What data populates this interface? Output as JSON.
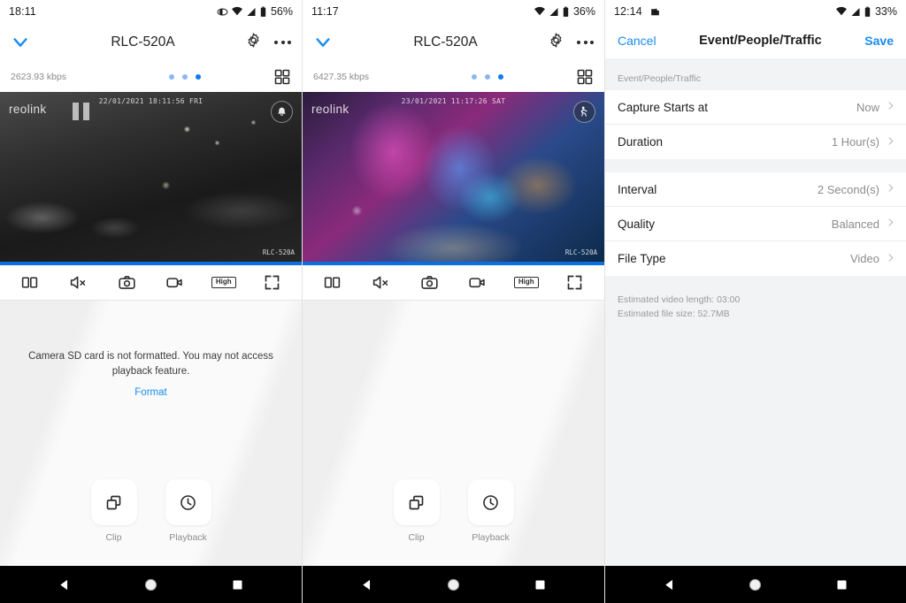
{
  "panels": [
    {
      "status": {
        "time": "18:11",
        "battery_pct": "56%",
        "icons": [
          "eye-icon",
          "wifi-icon",
          "signal-icon",
          "battery-icon"
        ]
      },
      "titlebar": {
        "chevron": "chevron-down-icon",
        "title": "RLC-520A",
        "gear": "gear-icon",
        "overflow": "more-options-icon"
      },
      "subbar": {
        "bitrate": "2623.93 kbps",
        "grid": "grid-view-icon",
        "dots": 3,
        "active_dot": 3
      },
      "video": {
        "watermark": "reolink",
        "timestamp": "22/01/2021 18:11:56 FRI",
        "model": "RLC-520A",
        "badge": "alert-bell-icon",
        "paused": true
      },
      "toolbar": [
        {
          "name": "split-screen-icon",
          "label": "Split"
        },
        {
          "name": "mute-icon",
          "label": "Mute"
        },
        {
          "name": "snapshot-camera-icon",
          "label": "Snapshot"
        },
        {
          "name": "record-video-icon",
          "label": "Record"
        },
        {
          "name": "quality-high-badge",
          "label": "High"
        },
        {
          "name": "fullscreen-icon",
          "label": "Fullscreen"
        }
      ],
      "playback": {
        "message": "Camera SD card is not formatted. You may not access playback feature.",
        "format_link": "Format",
        "actions": [
          {
            "icon": "clip-icon",
            "label": "Clip"
          },
          {
            "icon": "clock-playback-icon",
            "label": "Playback"
          }
        ]
      },
      "nav": [
        "back-icon",
        "home-icon",
        "recents-icon"
      ]
    },
    {
      "status": {
        "time": "11:17",
        "battery_pct": "36%",
        "icons": [
          "wifi-icon",
          "signal-icon",
          "battery-icon"
        ]
      },
      "titlebar": {
        "chevron": "chevron-down-icon",
        "title": "RLC-520A",
        "gear": "gear-icon",
        "overflow": "more-options-icon"
      },
      "subbar": {
        "bitrate": "6427.35 kbps",
        "grid": "grid-view-icon",
        "dots": 3,
        "active_dot": 3
      },
      "video": {
        "watermark": "reolink",
        "timestamp": "23/01/2021 11:17:26 SAT",
        "model": "RLC-520A",
        "badge": "ai-person-detect-icon",
        "paused": false
      },
      "toolbar": [
        {
          "name": "split-screen-icon",
          "label": "Split"
        },
        {
          "name": "mute-icon",
          "label": "Mute"
        },
        {
          "name": "snapshot-camera-icon",
          "label": "Snapshot"
        },
        {
          "name": "record-video-icon",
          "label": "Record"
        },
        {
          "name": "quality-high-badge",
          "label": "High"
        },
        {
          "name": "fullscreen-icon",
          "label": "Fullscreen"
        }
      ],
      "playback": {
        "message": "",
        "format_link": "",
        "actions": [
          {
            "icon": "clip-icon",
            "label": "Clip"
          },
          {
            "icon": "clock-playback-icon",
            "label": "Playback"
          }
        ]
      },
      "nav": [
        "back-icon",
        "home-icon",
        "recents-icon"
      ]
    }
  ],
  "settings": {
    "status": {
      "time": "12:14",
      "battery_pct": "33%",
      "left_icon": "notification-icon",
      "icons": [
        "wifi-icon",
        "signal-icon",
        "battery-icon"
      ]
    },
    "titlebar": {
      "cancel": "Cancel",
      "title": "Event/People/Traffic",
      "save": "Save"
    },
    "section_header": "Event/People/Traffic",
    "group1": [
      {
        "label": "Capture Starts at",
        "value": "Now"
      },
      {
        "label": "Duration",
        "value": "1 Hour(s)"
      }
    ],
    "group2": [
      {
        "label": "Interval",
        "value": "2 Second(s)"
      },
      {
        "label": "Quality",
        "value": "Balanced"
      },
      {
        "label": "File Type",
        "value": "Video"
      }
    ],
    "note_line1": "Estimated video length: 03:00",
    "note_line2": "Estimated file size: 52.7MB",
    "nav": [
      "back-icon",
      "home-icon",
      "recents-icon"
    ]
  },
  "colors": {
    "accent": "#1a8cf0",
    "progress": "#0b6fe0",
    "muted": "#8c8c8c",
    "nav_bg": "#000000"
  }
}
